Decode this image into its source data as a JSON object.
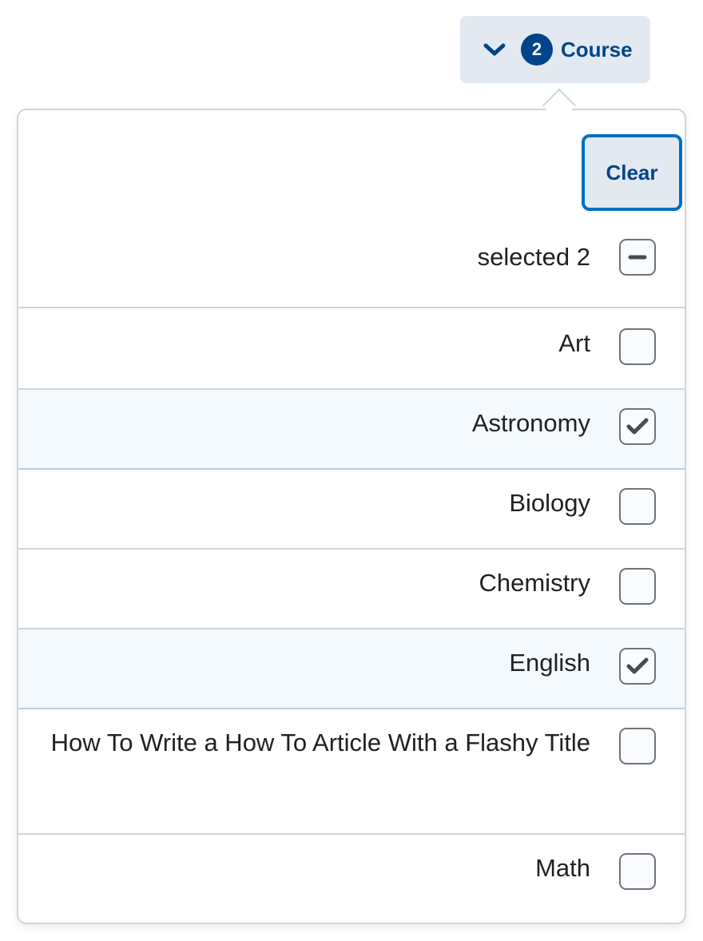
{
  "opener": {
    "count": "2",
    "label": "Course",
    "icon": "chevron-down-icon"
  },
  "panel": {
    "clear_label": "Clear",
    "select_all_label": "selected 2",
    "select_all_state": "indeterminate"
  },
  "options": [
    {
      "label": "Art",
      "checked": false
    },
    {
      "label": "Astronomy",
      "checked": true
    },
    {
      "label": "Biology",
      "checked": false
    },
    {
      "label": "Chemistry",
      "checked": false
    },
    {
      "label": "English",
      "checked": true
    },
    {
      "label": "How To Write a How To Article With a Flashy Title",
      "checked": false
    },
    {
      "label": "Math",
      "checked": false
    }
  ],
  "colors": {
    "accent": "#004489",
    "focus_ring": "#006fbf",
    "button_bg": "#e3e9f1",
    "selected_row_bg": "#f3f9fd"
  }
}
